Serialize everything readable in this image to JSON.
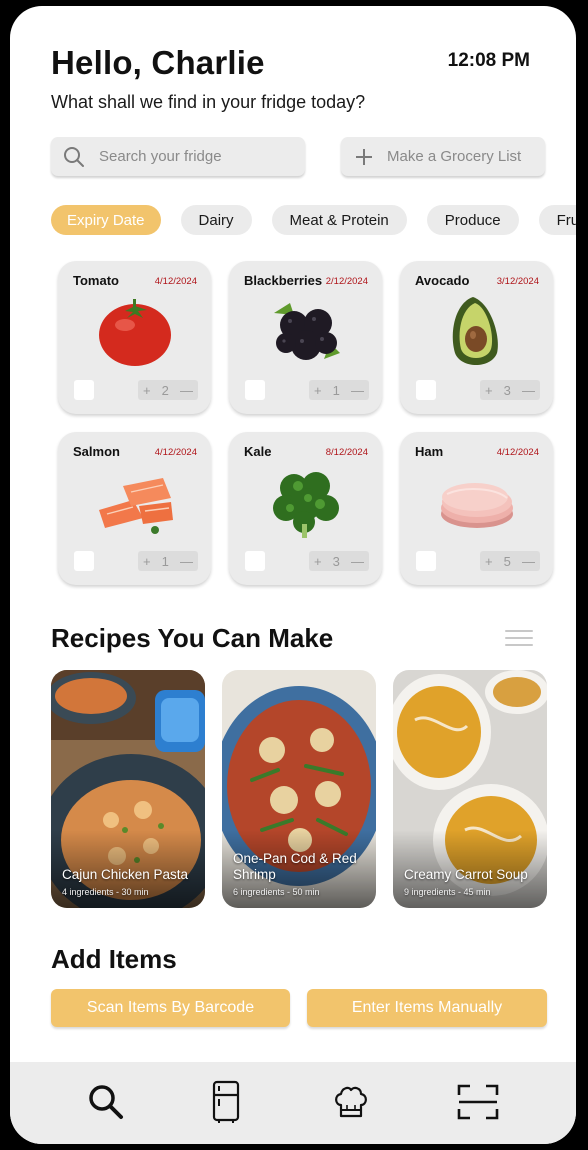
{
  "header": {
    "greeting": "Hello, Charlie",
    "time": "12:08 PM",
    "subtitle": "What shall we find in your fridge today?"
  },
  "search": {
    "placeholder": "Search your fridge",
    "icon": "search-icon"
  },
  "grocery": {
    "label": "Make a Grocery List",
    "icon": "plus-icon"
  },
  "filters": [
    {
      "label": "Expiry Date",
      "active": true
    },
    {
      "label": "Dairy",
      "active": false
    },
    {
      "label": "Meat & Protein",
      "active": false
    },
    {
      "label": "Produce",
      "active": false
    },
    {
      "label": "Fruit",
      "active": false
    }
  ],
  "items": [
    {
      "name": "Tomato",
      "date": "4/12/2024",
      "qty": "2",
      "icon": "tomato-image"
    },
    {
      "name": "Blackberries",
      "date": "2/12/2024",
      "qty": "1",
      "icon": "blackberries-image"
    },
    {
      "name": "Avocado",
      "date": "3/12/2024",
      "qty": "3",
      "icon": "avocado-image"
    },
    {
      "name": "Salmon",
      "date": "4/12/2024",
      "qty": "1",
      "icon": "salmon-image"
    },
    {
      "name": "Kale",
      "date": "8/12/2024",
      "qty": "3",
      "icon": "kale-image"
    },
    {
      "name": "Ham",
      "date": "4/12/2024",
      "qty": "5",
      "icon": "ham-image"
    }
  ],
  "stepper": {
    "plus": "+",
    "minus": "—"
  },
  "recipes_title": "Recipes You Can Make",
  "recipes": [
    {
      "name": "Cajun Chicken Pasta",
      "meta": "4 ingredients - 30 min"
    },
    {
      "name": "One-Pan Cod & Red Shrimp",
      "meta": "6 ingredients - 50 min"
    },
    {
      "name": "Creamy Carrot Soup",
      "meta": "9 ingredients - 45 min"
    }
  ],
  "add_items": {
    "title": "Add Items",
    "scan_label": "Scan Items By Barcode",
    "manual_label": "Enter Items Manually"
  },
  "tabbar": [
    "search-icon",
    "fridge-icon",
    "chef-hat-icon",
    "scan-icon"
  ],
  "colors": {
    "accent": "#f2c46c",
    "expiry": "#b0151a",
    "card": "#ebebeb"
  }
}
